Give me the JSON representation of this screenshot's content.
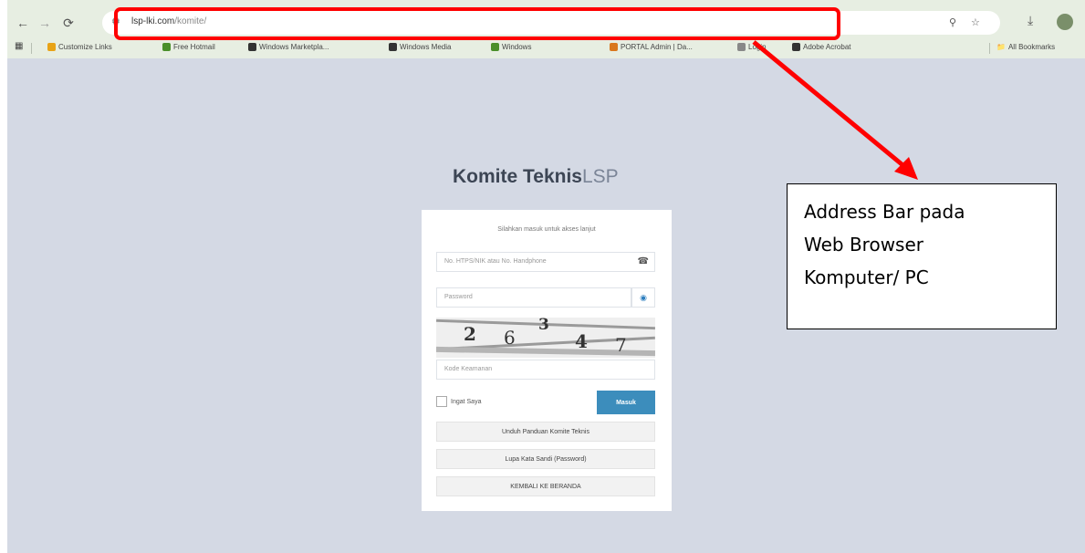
{
  "browser": {
    "url_host": "lsp-lki.com",
    "url_path": "/komite/",
    "bookmarks": [
      {
        "label": "Customize Links",
        "icon": "colorful-grid-icon",
        "color": "#e8a317"
      },
      {
        "label": "Free Hotmail",
        "icon": "windows-logo-icon",
        "color": "#4a8f2a"
      },
      {
        "label": "Windows Marketpla...",
        "icon": "globe-icon",
        "color": "#333333"
      },
      {
        "label": "Windows Media",
        "icon": "globe-icon",
        "color": "#333333"
      },
      {
        "label": "Windows",
        "icon": "windows-logo-icon",
        "color": "#4a8f2a"
      },
      {
        "label": "PORTAL Admin | Da...",
        "icon": "portal-icon",
        "color": "#d9771d"
      },
      {
        "label": "Login",
        "icon": "login-icon",
        "color": "#888888"
      },
      {
        "label": "Adobe Acrobat",
        "icon": "globe-icon",
        "color": "#333333"
      }
    ],
    "all_bookmarks": "All Bookmarks"
  },
  "page": {
    "title_bold": "Komite Teknis",
    "title_light": "LSP",
    "subtitle": "Silahkan masuk untuk akses lanjut",
    "username_placeholder": "No. HTPS/NIK atau No. Handphone",
    "password_placeholder": "Password",
    "captcha_digits": [
      "2",
      "6",
      "3",
      "4",
      "7"
    ],
    "captcha_placeholder": "Kode Keamanan",
    "remember_label": "Ingat Saya",
    "login_button": "Masuk",
    "guide_button": "Unduh Panduan Komite Teknis",
    "forgot_button": "Lupa Kata Sandi (Password)",
    "home_button": "KEMBALI KE BERANDA"
  },
  "callout": {
    "lines": [
      "Address Bar pada",
      "Web Browser",
      "Komputer/ PC"
    ]
  },
  "colors": {
    "highlight": "#ff0000",
    "login_button": "#3c8dbc",
    "page_background": "#d4d9e4"
  }
}
